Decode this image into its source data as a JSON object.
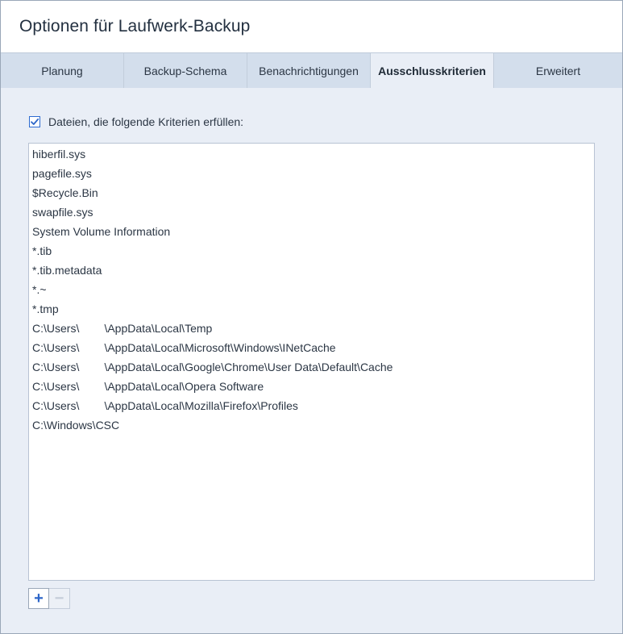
{
  "window": {
    "title": "Optionen für Laufwerk-Backup"
  },
  "tabs": [
    {
      "label": "Planung",
      "active": false
    },
    {
      "label": "Backup-Schema",
      "active": false
    },
    {
      "label": "Benachrichtigungen",
      "active": false
    },
    {
      "label": "Ausschlusskriterien",
      "active": true
    },
    {
      "label": "Erweitert",
      "active": false
    }
  ],
  "exclusion": {
    "checkbox_label": "Dateien, die folgende Kriterien erfüllen:",
    "checked": true,
    "items": [
      "hiberfil.sys",
      "pagefile.sys",
      "$Recycle.Bin",
      "swapfile.sys",
      "System Volume Information",
      "*.tib",
      "*.tib.metadata",
      "*.~",
      "*.tmp",
      "C:\\Users\\        \\AppData\\Local\\Temp",
      "C:\\Users\\        \\AppData\\Local\\Microsoft\\Windows\\INetCache",
      "C:\\Users\\        \\AppData\\Local\\Google\\Chrome\\User Data\\Default\\Cache",
      "C:\\Users\\        \\AppData\\Local\\Opera Software",
      "C:\\Users\\        \\AppData\\Local\\Mozilla\\Firefox\\Profiles",
      "C:\\Windows\\CSC"
    ]
  },
  "buttons": {
    "add_label": "+",
    "remove_label": "−"
  },
  "icons": {
    "checkmark": "checkmark-icon"
  },
  "colors": {
    "accent": "#2d66c8",
    "tab_bar": "#d3deec",
    "panel": "#e9eef6"
  }
}
